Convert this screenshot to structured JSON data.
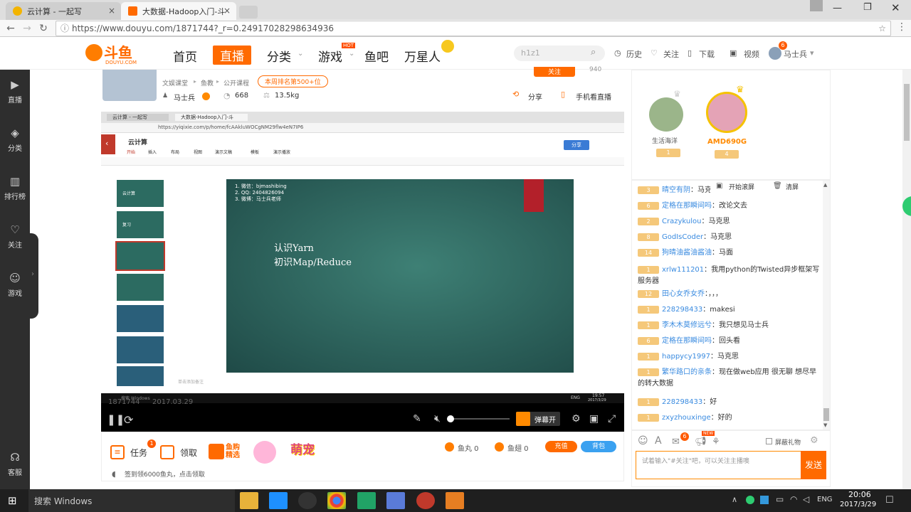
{
  "browser": {
    "tabs": [
      {
        "label": "云计算 - 一起写"
      },
      {
        "label": "大数据-Hadoop入门-斗"
      }
    ],
    "url": "https://www.douyu.com/1871744?_r=0.24917028298634936"
  },
  "header": {
    "logo_text": "斗鱼",
    "logo_sub": "DOUYU.COM",
    "nav": [
      "首页",
      "直播",
      "分类",
      "游戏",
      "鱼吧",
      "万星人"
    ],
    "hot_badge": "HOT",
    "search_placeholder": "h1z1",
    "links": [
      "历史",
      "关注",
      "下载",
      "视频"
    ],
    "user": "马士兵",
    "user_badge": "6"
  },
  "sidebar": {
    "items": [
      "直播",
      "分类",
      "排行榜",
      "关注",
      "游戏"
    ],
    "bottom": "客服"
  },
  "room": {
    "breadcrumb": [
      "文娱课堂",
      "鱼教",
      "公开课程"
    ],
    "rank_badge": "本周排名第500+位",
    "anchor": "马士兵",
    "viewers": "668",
    "weight": "13.5kg",
    "follow_label": "关注",
    "follow_count": "940",
    "share_label": "分享",
    "mobile_label": "手机看直播"
  },
  "stream": {
    "inner_tabs": [
      "云计算 - 一起写",
      "大数据-Hadoop入门-斗"
    ],
    "inner_url": "https://yiqixie.com/p/home/fcAAkluWOCgNM29flw4eN7IP6",
    "doc_title": "云计算",
    "share_btn": "分享",
    "menu": [
      "开始",
      "插入",
      "布局",
      "视图",
      "演示文稿",
      "模板",
      "演示播放"
    ],
    "slide_lines": [
      "1.    微信：bjmashibing",
      "2.    QQ:    2404826094",
      "3.    微博：马士兵老师"
    ],
    "slide_title1": "认识Yarn",
    "slide_title2": "初识Map/Reduce",
    "notes_placeholder": "单击添加备注",
    "thumb_labels": [
      "云计算",
      "复习"
    ],
    "room_num": "1871744",
    "date": "2017.03.29",
    "inner_taskbar_time": "19:57",
    "inner_taskbar_date": "2017/3/29",
    "inner_lang": "ENG",
    "search_text": "搜索 Windows"
  },
  "controls": {
    "barrage_btn": "弹幕开"
  },
  "bottombar": {
    "tasks": "任务",
    "tasks_badge": "1",
    "claim": "领取",
    "promo1": "鱼购精选",
    "promo2": "萌宠",
    "fish_ball": "鱼丸 0",
    "fish_fin": "鱼翅 0",
    "recharge": "充值",
    "backpack": "背包",
    "signin": "签到领6000鱼丸，点击领取"
  },
  "rank": [
    {
      "name": "生活海洋",
      "level": "1"
    },
    {
      "name": "AMD690G",
      "level": "4"
    }
  ],
  "chat": {
    "scroll_lock": "开始滚屏",
    "clear": "清屏",
    "messages": [
      {
        "level": "3",
        "user": "晴空有阴",
        "text": "马克"
      },
      {
        "level": "6",
        "user": "定格在那瞬间吗",
        "text": "改论文去"
      },
      {
        "level": "2",
        "user": "Crazykulou",
        "text": "马克思"
      },
      {
        "level": "8",
        "user": "GodIsCoder",
        "text": "马克思"
      },
      {
        "level": "14",
        "user": "狗晴油酱油酱油",
        "text": "马面"
      },
      {
        "level": "1",
        "user": "xrlw111201",
        "text": "我用python的Twisted异步框架写服务器"
      },
      {
        "level": "12",
        "user": "田心女乔女乔",
        "text": "，，，"
      },
      {
        "level": "1",
        "user": "228298433",
        "text": "makesi"
      },
      {
        "level": "1",
        "user": "李木木莫修远兮",
        "text": "我只想见马士兵"
      },
      {
        "level": "6",
        "user": "定格在那瞬间吗",
        "text": "回头看"
      },
      {
        "level": "1",
        "user": "happycy1997",
        "text": "马克思"
      },
      {
        "level": "1",
        "user": "繁华路口的亲条",
        "text": "现在做web应用 很无聊 想尽早的转大数据"
      },
      {
        "level": "1",
        "user": "228298433",
        "text": "好"
      },
      {
        "level": "1",
        "user": "zxyzhouxinge",
        "text": "好的"
      }
    ],
    "gift_block": "屏蔽礼物",
    "mail_badge": "6",
    "new_badge": "NEW",
    "input_placeholder": "试着输入\"#关注\"吧，可以关注主播噢",
    "send": "发送"
  },
  "taskbar": {
    "search": "搜索 Windows",
    "lang": "ENG",
    "time": "20:06",
    "date": "2017/3/29"
  }
}
